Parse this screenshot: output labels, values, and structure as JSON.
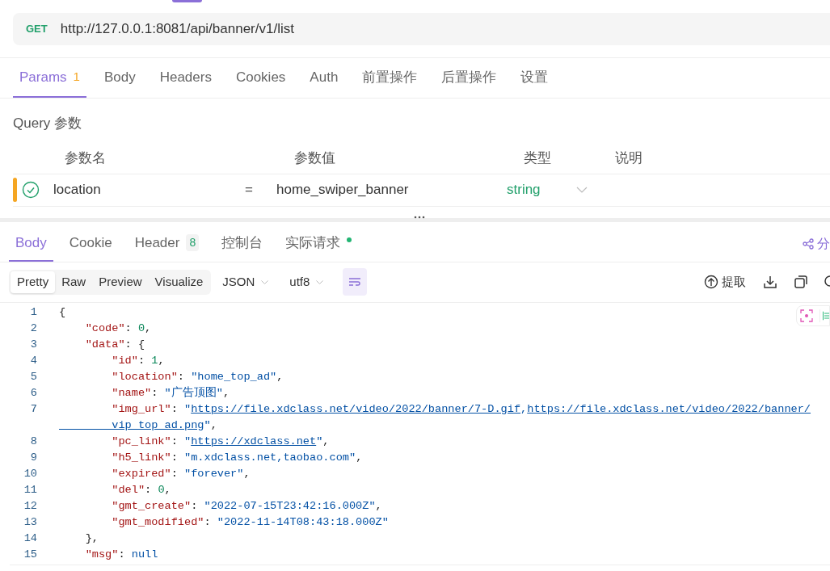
{
  "request": {
    "method": "GET",
    "url": "http://127.0.0.1:8081/api/banner/v1/list"
  },
  "request_tabs": [
    {
      "label": "Params",
      "badge": "1",
      "selected": true
    },
    {
      "label": "Body",
      "selected": false
    },
    {
      "label": "Headers",
      "selected": false
    },
    {
      "label": "Cookies",
      "selected": false
    },
    {
      "label": "Auth",
      "selected": false
    },
    {
      "label": "前置操作",
      "selected": false
    },
    {
      "label": "后置操作",
      "selected": false
    },
    {
      "label": "设置",
      "selected": false
    }
  ],
  "query_section": {
    "title": "Query 参数",
    "columns": [
      "参数名",
      "参数值",
      "类型",
      "说明"
    ],
    "rows": [
      {
        "enabled": true,
        "name": "location",
        "operator": "=",
        "value": "home_swiper_banner",
        "type": "string"
      }
    ]
  },
  "response_tabs": [
    {
      "label": "Body",
      "selected": true
    },
    {
      "label": "Cookie",
      "selected": false
    },
    {
      "label": "Header",
      "badge": "8",
      "selected": false
    },
    {
      "label": "控制台",
      "selected": false
    },
    {
      "label": "实际请求",
      "color": "#22b573",
      "selected": false
    }
  ],
  "share_label": "分",
  "view_modes": [
    {
      "label": "Pretty",
      "selected": true
    },
    {
      "label": "Raw",
      "selected": false
    },
    {
      "label": "Preview",
      "selected": false
    },
    {
      "label": "Visualize",
      "selected": false
    }
  ],
  "format_select": "JSON",
  "encoding_select": "utf8",
  "wrap_on": true,
  "extract_label": "提取",
  "code_lines": [
    {
      "number": "1",
      "tokens": [
        {
          "kind": "punct",
          "text": "{"
        }
      ]
    },
    {
      "number": "2",
      "tokens": [
        {
          "kind": "key",
          "text": "    \"code\""
        },
        {
          "kind": "punct",
          "text": ": "
        },
        {
          "kind": "number",
          "text": "0"
        },
        {
          "kind": "punct",
          "text": ","
        }
      ]
    },
    {
      "number": "3",
      "tokens": [
        {
          "kind": "key",
          "text": "    \"data\""
        },
        {
          "kind": "punct",
          "text": ": {"
        }
      ]
    },
    {
      "number": "4",
      "tokens": [
        {
          "kind": "key",
          "text": "        \"id\""
        },
        {
          "kind": "punct",
          "text": ": "
        },
        {
          "kind": "number",
          "text": "1"
        },
        {
          "kind": "punct",
          "text": ","
        }
      ]
    },
    {
      "number": "5",
      "tokens": [
        {
          "kind": "key",
          "text": "        \"location\""
        },
        {
          "kind": "punct",
          "text": ": "
        },
        {
          "kind": "string",
          "text": "\"home_top_ad\""
        },
        {
          "kind": "punct",
          "text": ","
        }
      ]
    },
    {
      "number": "6",
      "tokens": [
        {
          "kind": "key",
          "text": "        \"name\""
        },
        {
          "kind": "punct",
          "text": ": "
        },
        {
          "kind": "string",
          "text": "\"广告顶图\""
        },
        {
          "kind": "punct",
          "text": ","
        }
      ]
    },
    {
      "number": "7",
      "tokens": [
        {
          "kind": "key",
          "text": "        \"img_url\""
        },
        {
          "kind": "punct",
          "text": ": "
        },
        {
          "kind": "string",
          "text": "\""
        },
        {
          "kind": "link",
          "text": "https://file.xdclass.net/video/2022/banner/7-D.gif"
        },
        {
          "kind": "string",
          "text": ","
        },
        {
          "kind": "link",
          "text": "https://file.xdclass.net/video/2022/banner/"
        }
      ]
    },
    {
      "tokens": [
        {
          "kind": "link",
          "text": "        vip_top_ad.png"
        },
        {
          "kind": "string",
          "text": "\""
        },
        {
          "kind": "punct",
          "text": ","
        }
      ]
    },
    {
      "number": "8",
      "tokens": [
        {
          "kind": "key",
          "text": "        \"pc_link\""
        },
        {
          "kind": "punct",
          "text": ": "
        },
        {
          "kind": "string",
          "text": "\""
        },
        {
          "kind": "link",
          "text": "https://xdclass.net"
        },
        {
          "kind": "string",
          "text": "\""
        },
        {
          "kind": "punct",
          "text": ","
        }
      ]
    },
    {
      "number": "9",
      "tokens": [
        {
          "kind": "key",
          "text": "        \"h5_link\""
        },
        {
          "kind": "punct",
          "text": ": "
        },
        {
          "kind": "string",
          "text": "\"m.xdclass.net,taobao.com\""
        },
        {
          "kind": "punct",
          "text": ","
        }
      ]
    },
    {
      "number": "10",
      "tokens": [
        {
          "kind": "key",
          "text": "        \"expired\""
        },
        {
          "kind": "punct",
          "text": ": "
        },
        {
          "kind": "string",
          "text": "\"forever\""
        },
        {
          "kind": "punct",
          "text": ","
        }
      ]
    },
    {
      "number": "11",
      "tokens": [
        {
          "kind": "key",
          "text": "        \"del\""
        },
        {
          "kind": "punct",
          "text": ": "
        },
        {
          "kind": "number",
          "text": "0"
        },
        {
          "kind": "punct",
          "text": ","
        }
      ]
    },
    {
      "number": "12",
      "tokens": [
        {
          "kind": "key",
          "text": "        \"gmt_create\""
        },
        {
          "kind": "punct",
          "text": ": "
        },
        {
          "kind": "string",
          "text": "\"2022-07-15T23:42:16.000Z\""
        },
        {
          "kind": "punct",
          "text": ","
        }
      ]
    },
    {
      "number": "13",
      "tokens": [
        {
          "kind": "key",
          "text": "        \"gmt_modified\""
        },
        {
          "kind": "punct",
          "text": ": "
        },
        {
          "kind": "string",
          "text": "\"2022-11-14T08:43:18.000Z\""
        }
      ]
    },
    {
      "number": "14",
      "tokens": [
        {
          "kind": "punct",
          "text": "    },"
        }
      ]
    },
    {
      "number": "15",
      "tokens": [
        {
          "kind": "key",
          "text": "    \"msg\""
        },
        {
          "kind": "punct",
          "text": ": "
        },
        {
          "kind": "keyword",
          "text": "null"
        }
      ]
    }
  ]
}
